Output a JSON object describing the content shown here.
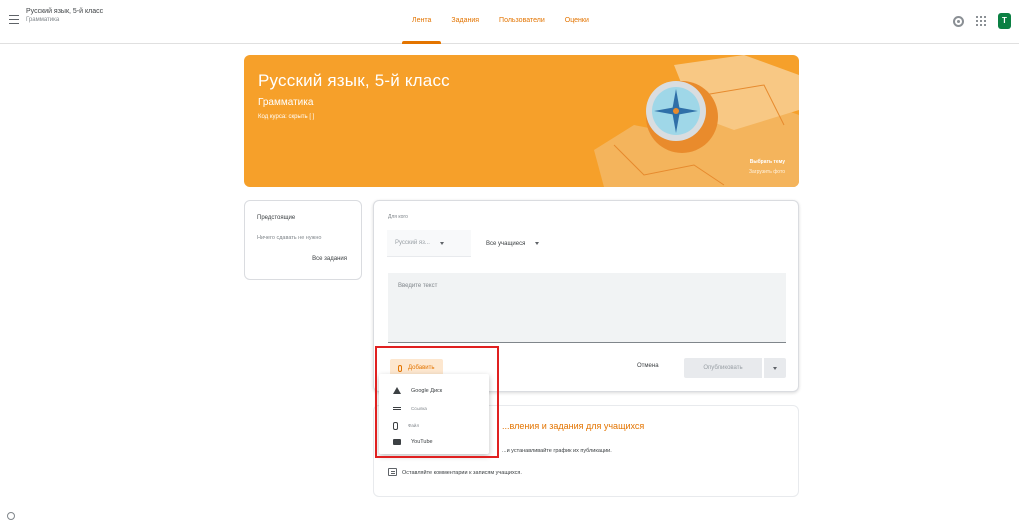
{
  "header": {
    "course_title": "Русский язык, 5-й класс",
    "course_subtitle": "Грамматика",
    "tabs": [
      {
        "label": "Лента",
        "active": true
      },
      {
        "label": "Задания",
        "active": false
      },
      {
        "label": "Пользователи",
        "active": false
      },
      {
        "label": "Оценки",
        "active": false
      }
    ],
    "avatar_letter": "T",
    "accent_color": "#e37400"
  },
  "banner": {
    "title": "Русский язык, 5-й класс",
    "subtitle": "Грамматика",
    "code_label": "Код курса: скрыть [ ]",
    "select_theme": "Выбрать тему",
    "upload_photo": "Загрузить фото",
    "color": "#f6a02a"
  },
  "upcoming": {
    "title": "Предстоящие",
    "empty_text": "Ничего сдавать не нужно",
    "all_link": "Все задания"
  },
  "composer": {
    "for_label": "Для кого",
    "course_select": "Русский яз...",
    "students_select": "Все учащиеся",
    "text_placeholder": "Введите текст",
    "add_button": "Добавить",
    "cancel_button": "Отмена",
    "publish_button": "Опубликовать"
  },
  "add_menu": {
    "items": [
      {
        "label": "Google Диск",
        "icon": "drive-icon"
      },
      {
        "label": "Ссылка",
        "icon": "link-icon"
      },
      {
        "label": "Файл",
        "icon": "file-icon"
      },
      {
        "label": "YouTube",
        "icon": "youtube-icon"
      }
    ]
  },
  "info_card": {
    "title": "...вления и задания для учащихся",
    "line1": "...и устанавливайте график их публикации.",
    "line2": "Оставляйте комментарии к записям учащихся."
  }
}
